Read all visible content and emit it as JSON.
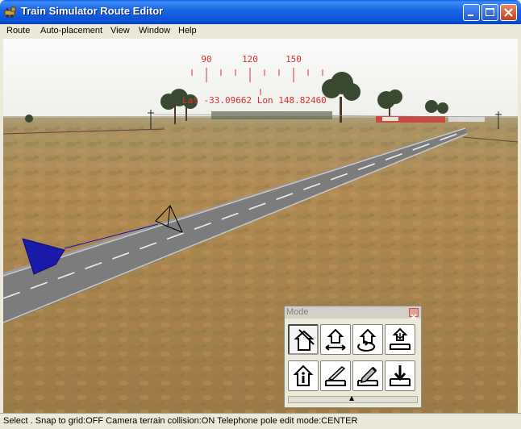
{
  "window": {
    "title": "Train Simulator Route Editor"
  },
  "menu": {
    "items": [
      {
        "label": "Route"
      },
      {
        "label": "Auto-placement"
      },
      {
        "label": "View"
      },
      {
        "label": "Window"
      },
      {
        "label": "Help"
      }
    ]
  },
  "compass": {
    "ticks": [
      "90",
      "120",
      "150"
    ],
    "coords": "Lat -33.09662 Lon 148.82460"
  },
  "mode_panel": {
    "title": "Mode",
    "tools": [
      {
        "icon": "select-object-icon",
        "active": true
      },
      {
        "icon": "move-object-icon",
        "active": false
      },
      {
        "icon": "rotate-object-icon",
        "active": false
      },
      {
        "icon": "raise-lower-object-icon",
        "active": false
      },
      {
        "icon": "object-info-icon",
        "active": false
      },
      {
        "icon": "terrain-knife-icon",
        "active": false
      },
      {
        "icon": "terrain-paint-icon",
        "active": false
      },
      {
        "icon": "terrain-height-icon",
        "active": false
      }
    ],
    "expand_glyph": "▲"
  },
  "status": {
    "text": "Select . Snap to grid:OFF Camera terrain collision:ON Telephone pole edit mode:CENTER"
  },
  "colors": {
    "titlebar": "#0a5ee8",
    "hud_red": "#d83030",
    "road": "#808080",
    "terrain": "#b08a52",
    "sky": "#f4f4f2"
  }
}
